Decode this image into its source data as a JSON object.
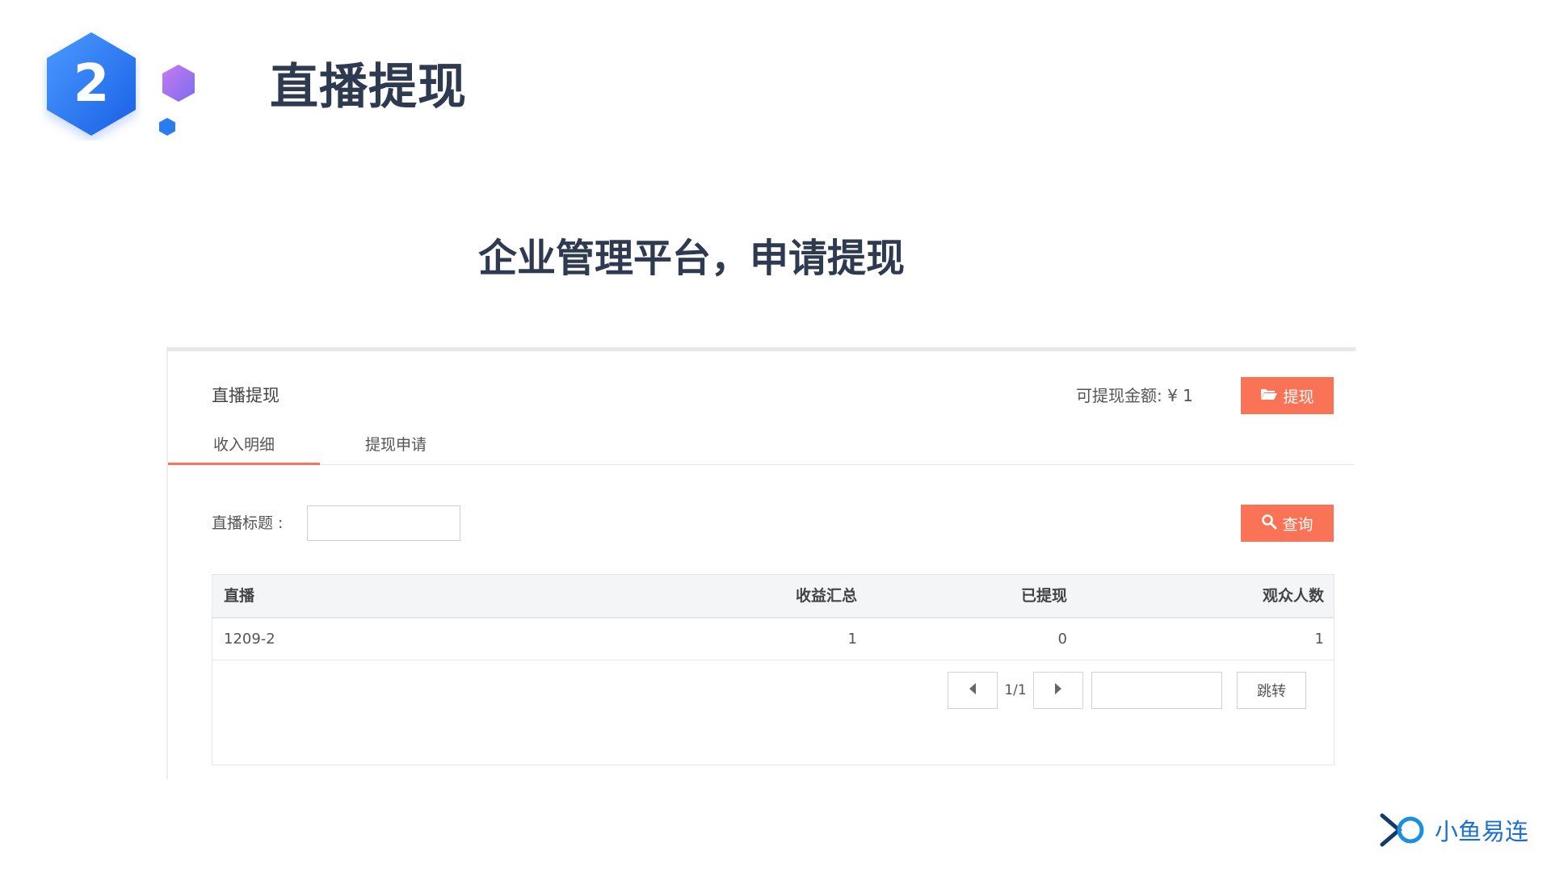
{
  "slide": {
    "step_number": "2",
    "title": "直播提现",
    "subtitle": "企业管理平台，申请提现"
  },
  "panel": {
    "title": "直播提现",
    "balance_label": "可提现金额: ¥ 1",
    "withdraw_button_label": "提现",
    "tabs": [
      {
        "label": "收入明细",
        "active": true
      },
      {
        "label": "提现申请",
        "active": false
      }
    ],
    "filter": {
      "label": "直播标题 :",
      "value": "",
      "search_button_label": "查询"
    },
    "table": {
      "columns": [
        "直播",
        "收益汇总",
        "已提现",
        "观众人数"
      ],
      "rows": [
        [
          "1209-2",
          "1",
          "0",
          "1"
        ]
      ]
    },
    "pagination": {
      "page_info": "1/1",
      "jump_value": "",
      "jump_button_label": "跳转"
    }
  },
  "brand": {
    "name": "小鱼易连"
  },
  "colors": {
    "accent": "#fa7356",
    "title": "#2e3a4f",
    "brand_blue": "#1a6fd1",
    "badge_gradient_start": "#3a8cff",
    "badge_gradient_end": "#1f63e8"
  },
  "icons": {
    "withdraw_button": "folder-open-icon",
    "search_button": "search-icon",
    "pager_prev": "caret-left-icon",
    "pager_next": "caret-right-icon"
  }
}
